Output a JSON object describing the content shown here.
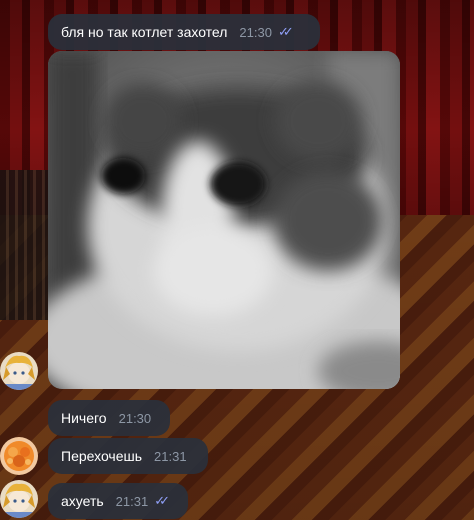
{
  "chat": {
    "messages": [
      {
        "text": "бля но так котлет захотел",
        "time": "21:30",
        "read_ticks": "✓✓",
        "outgoing": true
      },
      {
        "type": "photo",
        "image_icon": "cat-photo",
        "outgoing": true
      },
      {
        "text": "Ничего",
        "time": "21:30",
        "sender_avatar": "anime-avatar"
      },
      {
        "text": "Перехочешь",
        "time": "21:31",
        "sender_avatar": "orange-avatar"
      },
      {
        "text": "ахуеть",
        "time": "21:31",
        "read_ticks": "✓✓",
        "sender_avatar": "anime-avatar"
      }
    ]
  },
  "colors": {
    "bubble": "#2a303a",
    "time_text": "#8d97a5",
    "read_ticks": "#8f9ff6",
    "curtain_red": "#7a1010",
    "floor_brown": "#6b2f14"
  }
}
